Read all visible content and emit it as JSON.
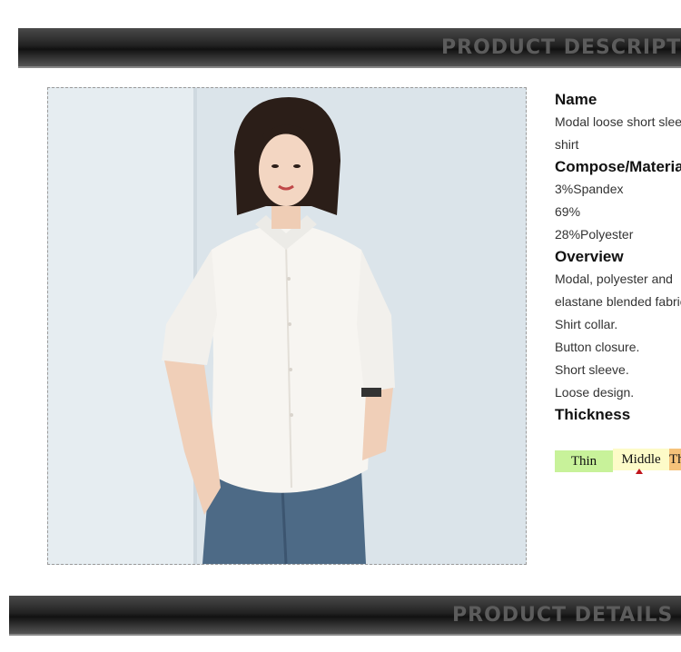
{
  "banner_top": {
    "title": "PRODUCT DESCRIPTION"
  },
  "banner_bottom": {
    "title": "PRODUCT DETAILS"
  },
  "info": {
    "name_label": "Name",
    "name_line1": "Modal loose short sleeve",
    "name_line2": "shirt",
    "compose_label": "Compose/Material",
    "compose_1": "3%Spandex",
    "compose_2": "69%",
    "compose_3": "28%Polyester",
    "overview_label": "Overview",
    "overview_1": "Modal, polyester and",
    "overview_2": "elastane blended fabric.",
    "overview_3": "Shirt collar.",
    "overview_4": "Button closure.",
    "overview_5": "Short sleeve.",
    "overview_6": "Loose design.",
    "thickness_label": "Thickness"
  },
  "thickness": {
    "options": [
      "Thin",
      "Middle",
      "Thick"
    ],
    "selected": "Middle",
    "colors": {
      "thin": "#c8f29a",
      "middle": "#fdfbc8",
      "thick": "#f6c27a",
      "marker": "#c0141c"
    }
  }
}
